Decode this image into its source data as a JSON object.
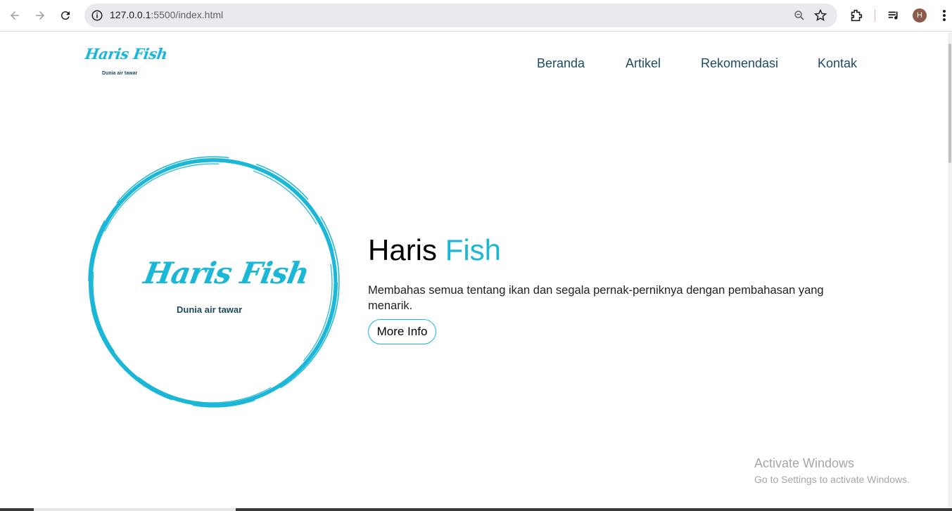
{
  "browser": {
    "url_host": "127.0.0.1",
    "url_rest": ":5500/index.html",
    "avatar_letter": "H"
  },
  "site": {
    "logo_script": "Haris Fish",
    "logo_tagline": "Dunia air tawar",
    "nav": [
      "Beranda",
      "Artikel",
      "Rekomendasi",
      "Kontak"
    ]
  },
  "hero": {
    "title_main": "Haris",
    "title_accent": "Fish",
    "description": "Membahas semua tentang ikan dan segala pernak-perniknya dengan pembahasan yang menarik.",
    "button_label": "More Info",
    "logo_script": "Haris Fish",
    "logo_tagline": "Dunia air tawar"
  },
  "watermark": {
    "title": "Activate Windows",
    "subtitle": "Go to Settings to activate Windows."
  },
  "colors": {
    "accent": "#1ab7d9",
    "nav_text": "#1f4b5e",
    "tagline": "#1d4a5c"
  }
}
